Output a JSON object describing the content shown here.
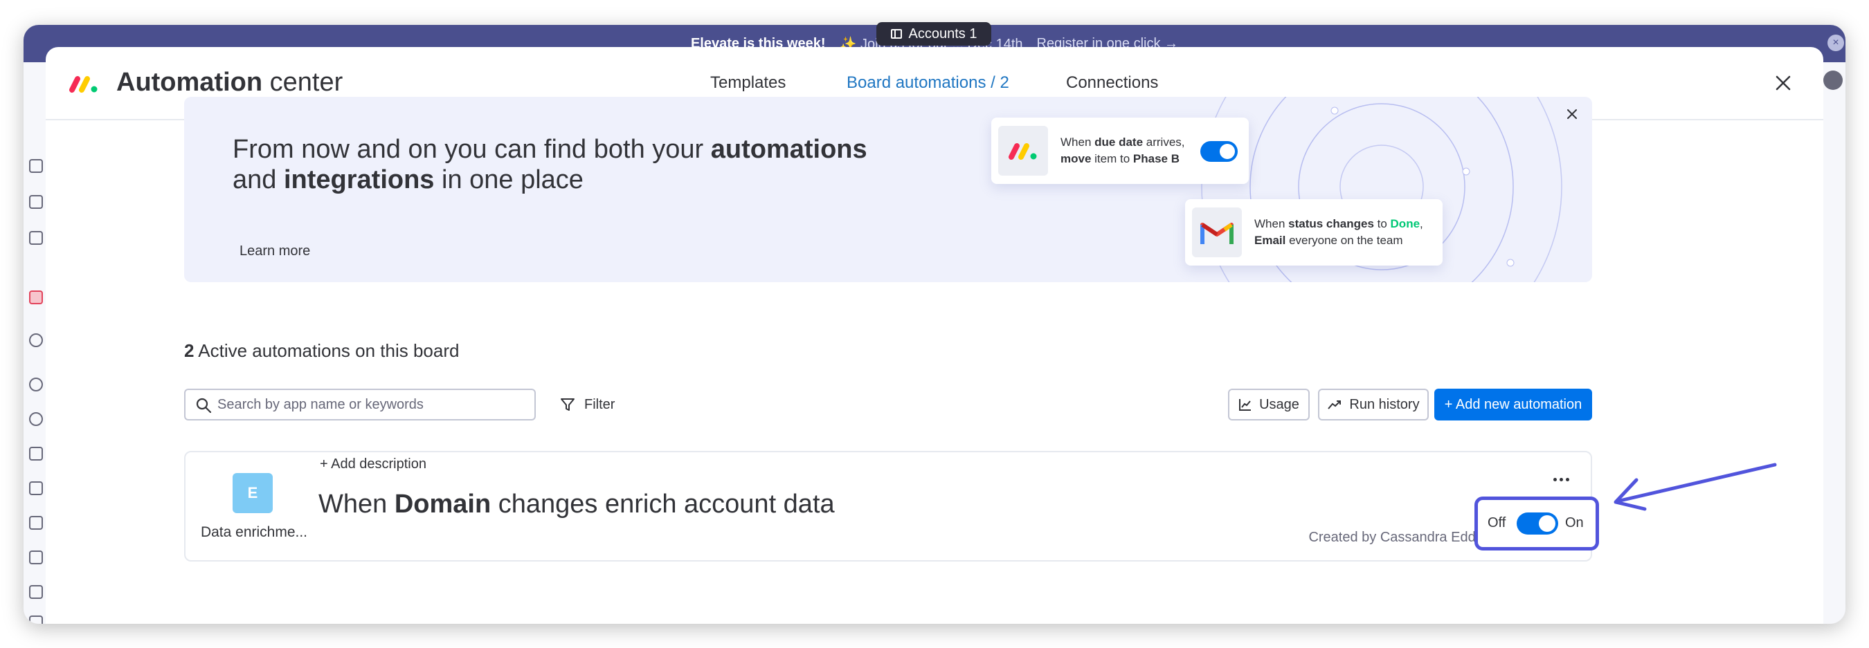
{
  "banner": {
    "bold": "Elevate is this week!",
    "text": "✨ Join us for our ... Dec 14th",
    "cta": "Register in one click →"
  },
  "tab_pill": {
    "label": "Accounts 1"
  },
  "header": {
    "title_strong": "Automation",
    "title_rest": "center",
    "tabs": [
      {
        "label": "Templates"
      },
      {
        "label": "Board automations / 2"
      },
      {
        "label": "Connections"
      }
    ]
  },
  "promo": {
    "line1_pre": "From now and on you can find both your ",
    "line1_bold": "automations",
    "line2_pre": "and ",
    "line2_bold": "integrations",
    "line2_post": " in one place",
    "learn_more": "Learn more",
    "card1": {
      "t1": "When ",
      "b1": "due date",
      "t2": " arrives, ",
      "b2": "move",
      "t3": " item to ",
      "b3": "Phase B"
    },
    "card2": {
      "t1": "When ",
      "b1": "status changes",
      "t2": " to ",
      "g1": "Done",
      "t3": ", ",
      "b2": "Email",
      "t4": " everyone on the team"
    }
  },
  "automations": {
    "count": "2",
    "heading_rest": " Active automations on this board",
    "search_placeholder": "Search by app name or keywords",
    "filter_label": "Filter",
    "usage_label": "Usage",
    "run_history_label": "Run history",
    "add_label": "+ Add new automation",
    "items": [
      {
        "badge": "E",
        "app_name": "Data enrichme...",
        "add_description": "+ Add description",
        "sentence_pre": "When ",
        "sentence_bold": "Domain",
        "sentence_post": " changes enrich account data",
        "created_by": "Created by Cassandra Eddington · Updat...",
        "toggle": {
          "off": "Off",
          "on": "On",
          "state": "on"
        }
      }
    ]
  },
  "colors": {
    "primary": "#0073ea",
    "highlight": "#5154dc",
    "banner": "#4a4f8e"
  }
}
